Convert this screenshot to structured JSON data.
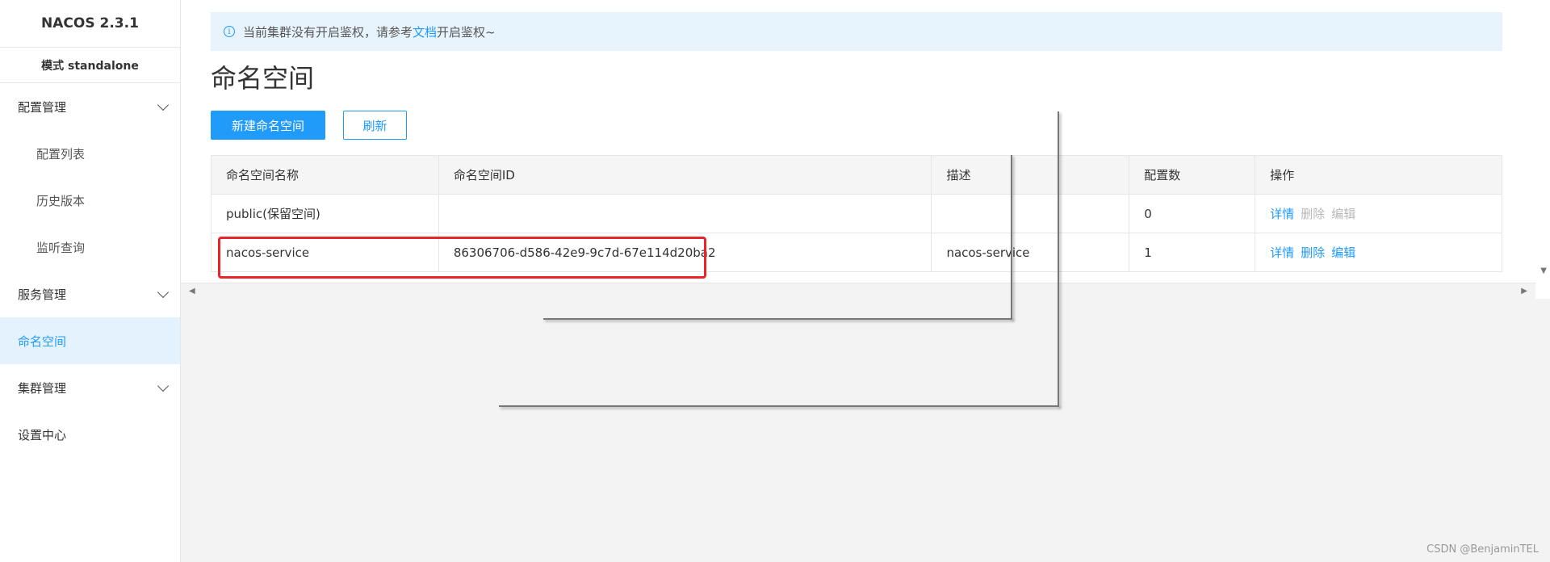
{
  "sidebar": {
    "title": "NACOS 2.3.1",
    "mode": "模式 standalone",
    "groups": [
      {
        "label": "配置管理",
        "items": [
          {
            "label": "配置列表"
          },
          {
            "label": "历史版本"
          },
          {
            "label": "监听查询"
          }
        ]
      },
      {
        "label": "服务管理"
      },
      {
        "label": "命名空间",
        "active": true
      },
      {
        "label": "集群管理"
      },
      {
        "label": "设置中心"
      }
    ]
  },
  "notice": {
    "text_before": "当前集群没有开启鉴权，请参考",
    "link": "文档",
    "text_after": "开启鉴权~"
  },
  "page": {
    "title": "命名空间",
    "create_button": "新建命名空间",
    "refresh_button": "刷新"
  },
  "table": {
    "headers": [
      "命名空间名称",
      "命名空间ID",
      "描述",
      "配置数",
      "操作"
    ],
    "rows": [
      {
        "name": "public(保留空间)",
        "id": "",
        "desc": "",
        "count": "0",
        "actions": [
          "详情",
          "删除",
          "编辑"
        ],
        "enabled": [
          true,
          false,
          false
        ]
      },
      {
        "name": "nacos-service",
        "id": "86306706-d586-42e9-9c7d-67e114d20ba2",
        "desc": "nacos-service",
        "count": "1",
        "actions": [
          "详情",
          "删除",
          "编辑"
        ],
        "enabled": [
          true,
          true,
          true
        ]
      }
    ]
  },
  "icons": {
    "info": "info-icon",
    "expand": "chevron-down-icon"
  },
  "colors": {
    "accent": "#209bfa",
    "highlight": "#e8262a",
    "active_bg": "#e4f2fd"
  },
  "watermark": "CSDN @BenjaminTEL"
}
